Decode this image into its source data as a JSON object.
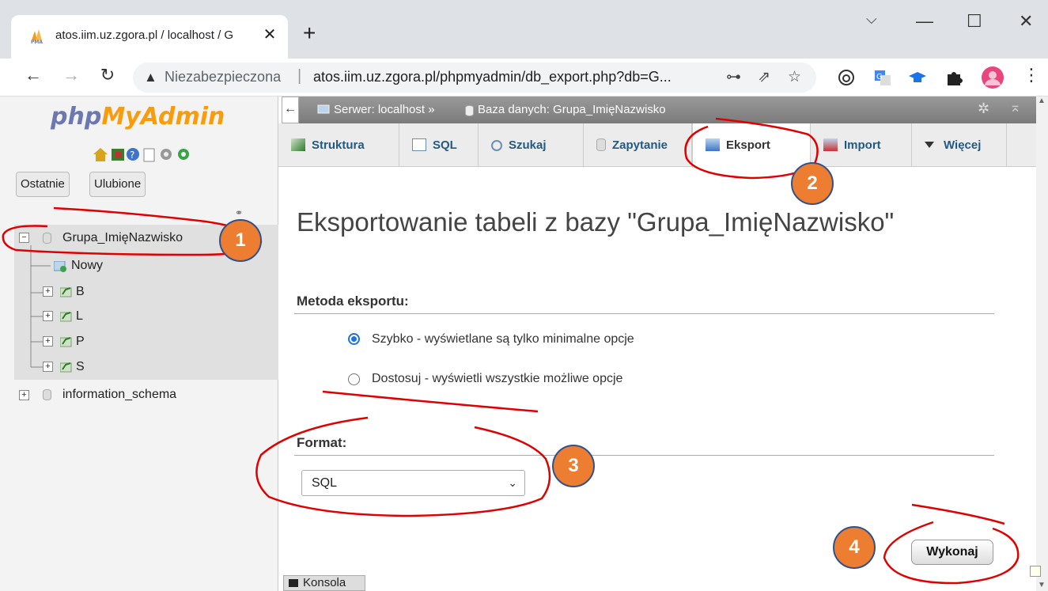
{
  "browser": {
    "tab_title": "atos.iim.uz.zgora.pl / localhost / G",
    "tab_close": "✕",
    "new_tab": "+",
    "insecure_label": "Niezabezpieczona",
    "url": "atos.iim.uz.zgora.pl/phpmyadmin/db_export.php?db=G...",
    "separator": "|"
  },
  "nav": {
    "logo_php": "php",
    "logo_my": "MyAdmin",
    "recent_btn": "Ostatnie",
    "favorites_btn": "Ulubione",
    "tree": {
      "db1": "Grupa_ImięNazwisko",
      "new_item": "Nowy",
      "tables": [
        "B",
        "L",
        "P",
        "S"
      ],
      "db2": "information_schema"
    }
  },
  "main": {
    "breadcrumb_server": "Serwer: localhost »",
    "breadcrumb_db": "Baza danych: Grupa_ImięNazwisko",
    "menu": [
      "Struktura",
      "SQL",
      "Szukaj",
      "Zapytanie",
      "Eksport",
      "Import",
      "Więcej"
    ],
    "page_title": "Eksportowanie tabeli z bazy \"Grupa_ImięNazwisko\"",
    "method_heading": "Metoda eksportu:",
    "method_quick": "Szybko - wyświetlane są tylko minimalne opcje",
    "method_custom": "Dostosuj - wyświetli wszystkie możliwe opcje",
    "format_heading": "Format:",
    "format_value": "SQL",
    "go_button": "Wykonaj",
    "console": "Konsola"
  },
  "annotations": {
    "badges": [
      "1",
      "2",
      "3",
      "4"
    ],
    "color": "#ed7d31",
    "ink": "#e00000"
  }
}
